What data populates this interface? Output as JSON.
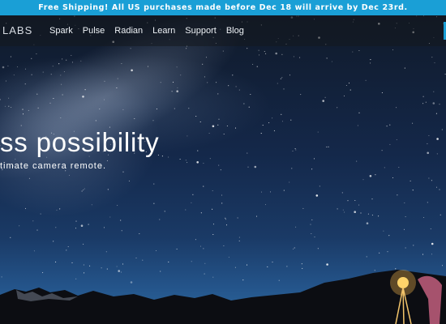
{
  "promo": {
    "text": "Free Shipping! All US purchases made before Dec 18 will arrive by Dec 23rd."
  },
  "nav": {
    "logo": "LABS",
    "links": [
      "Spark",
      "Pulse",
      "Radian",
      "Learn",
      "Support",
      "Blog"
    ]
  },
  "hero": {
    "headline": "ss possibility",
    "subhead": "timate camera remote."
  },
  "colors": {
    "accent": "#1a9fd6",
    "nav_text": "#eef2f6",
    "sky_dark": "#101a2a",
    "sky_light": "#2d6aa0"
  }
}
